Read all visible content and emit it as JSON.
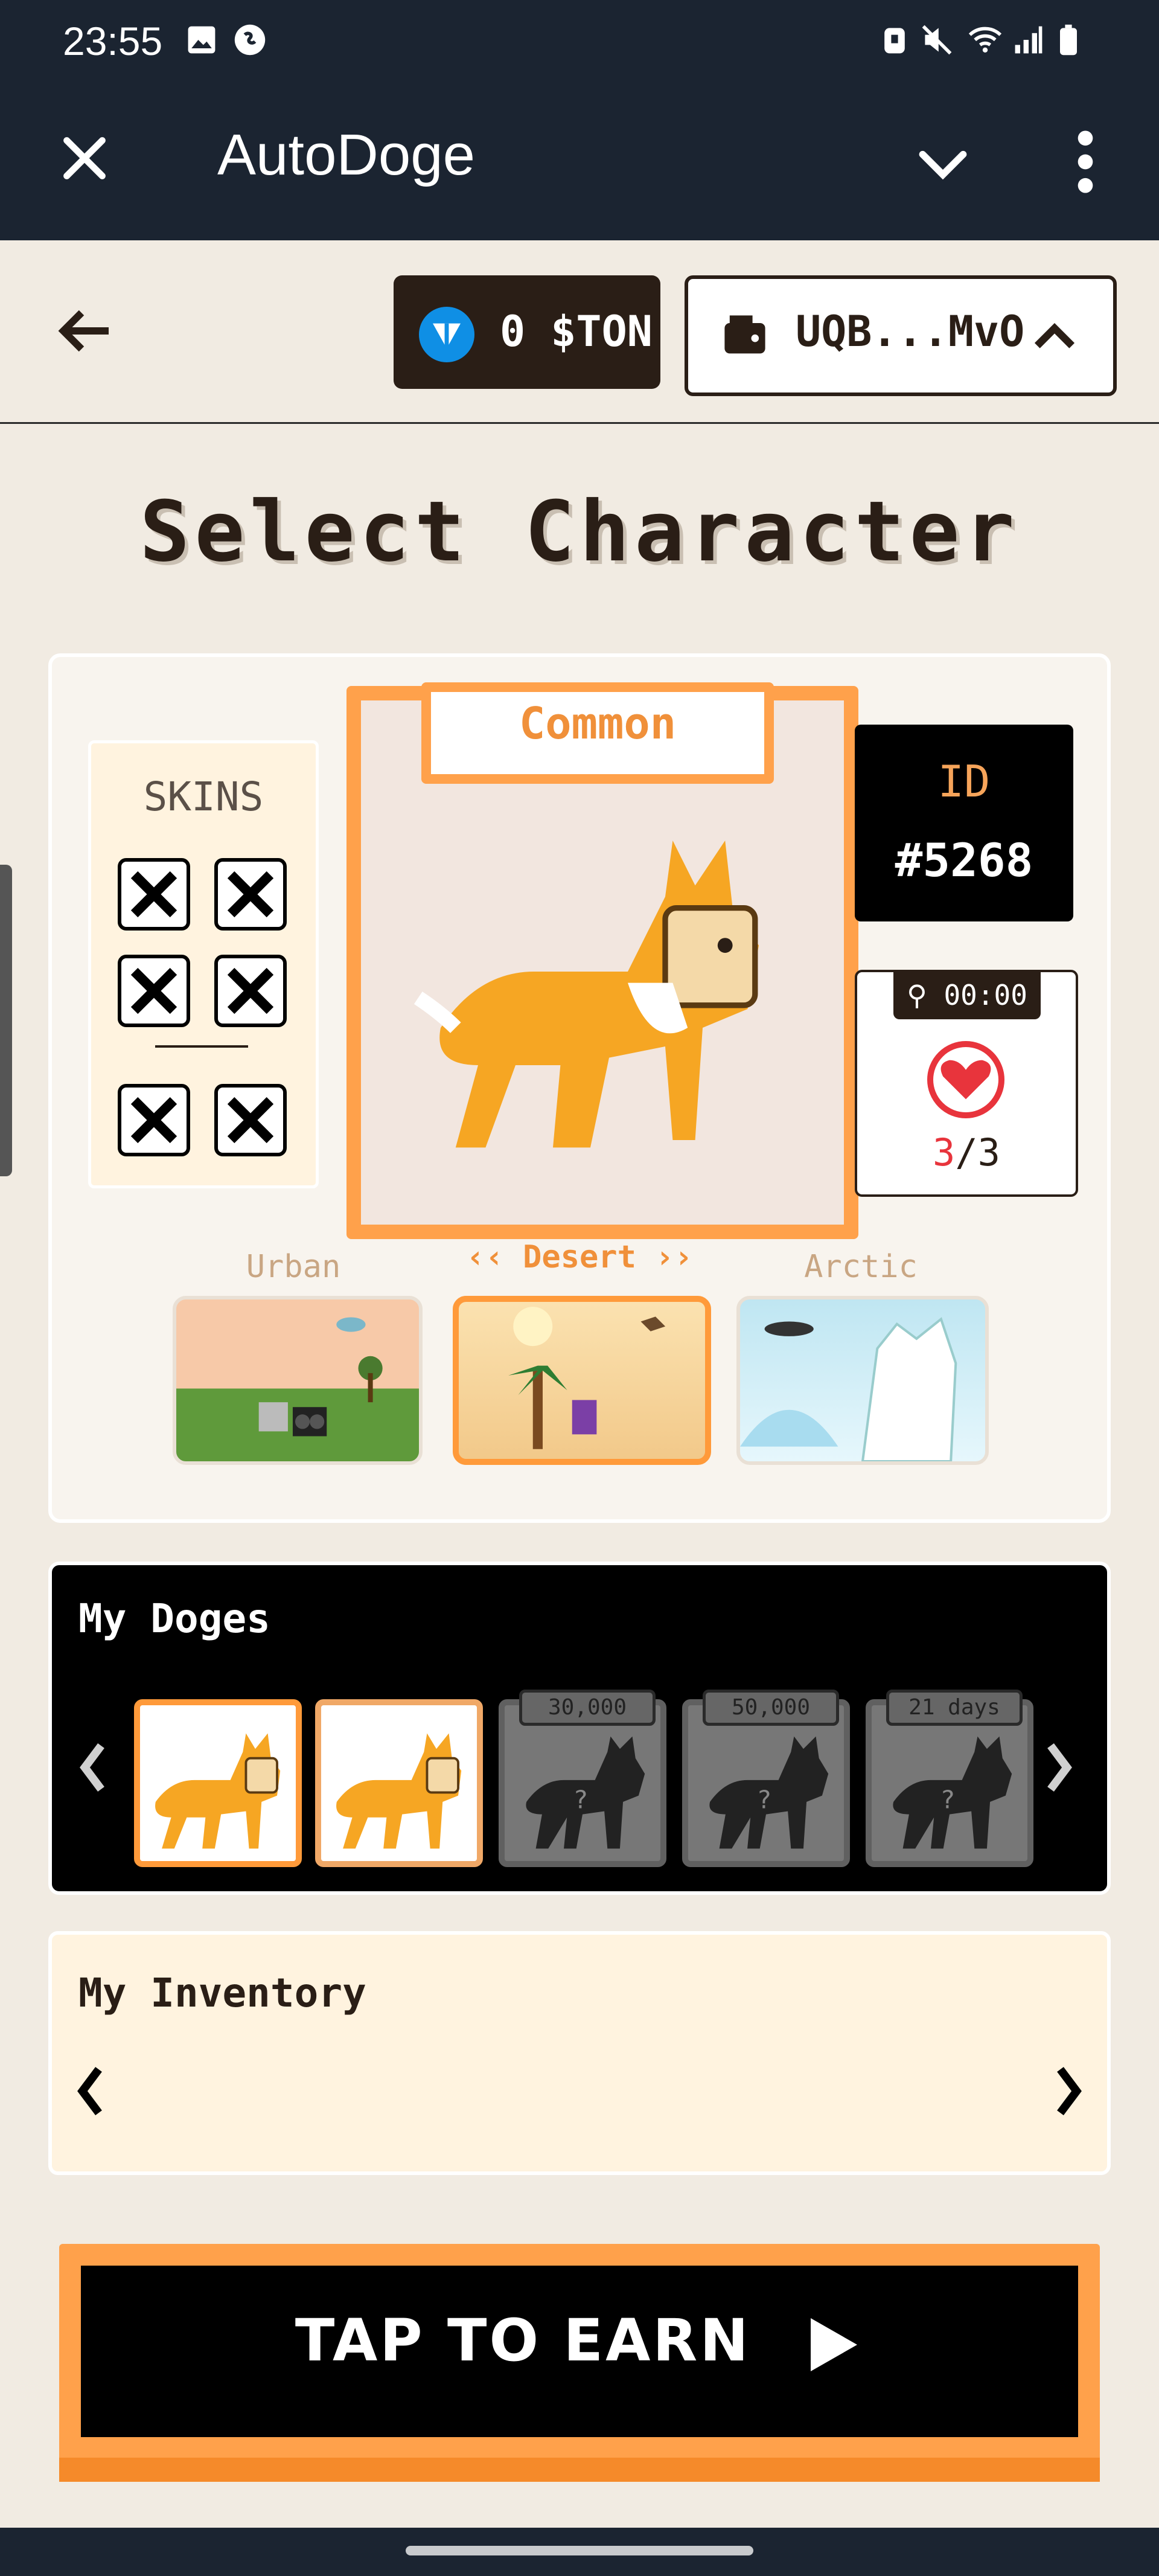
{
  "status_bar": {
    "time": "23:55"
  },
  "app_bar": {
    "title": "AutoDoge"
  },
  "sub_header": {
    "ton_balance": "0 $TON",
    "wallet_address": "UQB...MvO"
  },
  "page_title": "Select Character",
  "character": {
    "rarity": "Common",
    "id_label": "ID",
    "id_value": "#5268",
    "timer": "00:00",
    "lives_current": "3",
    "lives_sep_max": "/3",
    "skins_title": "SKINS"
  },
  "worlds": {
    "items": [
      {
        "label": "Urban"
      },
      {
        "label": "Desert"
      },
      {
        "label": "Arctic"
      }
    ],
    "selected_prefix": "‹‹",
    "selected_suffix": "››"
  },
  "my_doges": {
    "title": "My Doges",
    "locked": [
      {
        "tag": "30,000"
      },
      {
        "tag": "50,000"
      },
      {
        "tag": "21 days"
      }
    ]
  },
  "inventory": {
    "title": "My Inventory"
  },
  "cta": {
    "label": "TAP TO EARN"
  },
  "colors": {
    "accent": "#ffa14b",
    "dark": "#1b2431",
    "background": "#f1ebe2"
  }
}
